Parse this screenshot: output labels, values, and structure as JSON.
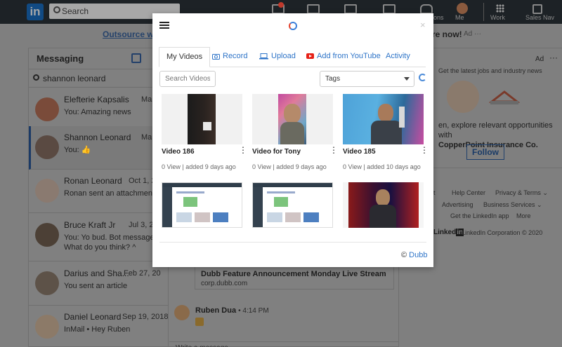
{
  "topbar": {
    "search_placeholder": "Search",
    "nav": [
      {
        "label": "",
        "icon": "home-icon"
      },
      {
        "label": "",
        "icon": "network-icon"
      },
      {
        "label": "",
        "icon": "jobs-icon"
      },
      {
        "label": "",
        "icon": "messaging-icon"
      },
      {
        "label": "ons",
        "icon": "notifications-icon"
      },
      {
        "label": "Me",
        "icon": "avatar"
      },
      {
        "label": "Work",
        "icon": "grid-icon"
      },
      {
        "label": "Sales Nav",
        "icon": "sales-nav-icon"
      }
    ]
  },
  "banner": {
    "left": "Outsource with",
    "right": "re now!",
    "ad_label": "Ad",
    "dots": "···"
  },
  "messaging": {
    "title": "Messaging",
    "search_value": "shannon leonard",
    "conversations": [
      {
        "name": "Elefterie Kapsalis",
        "date": "Mar",
        "preview": "You: Amazing news",
        "avatar_color": "#7a4b3a"
      },
      {
        "name": "Shannon Leonard",
        "date": "Mar",
        "preview": "You: 👍",
        "avatar_color": "#5a4a42"
      },
      {
        "name": "Ronan Leonard",
        "date": "Oct 1, 2",
        "preview": "Ronan sent an attachment",
        "avatar_color": "#8a7a70"
      },
      {
        "name": "Bruce Kraft Jr",
        "date": "Jul 3, 20",
        "preview": "You: Yo bud. Bot message. What do you think? ^",
        "avatar_color": "#4c4036"
      },
      {
        "name": "Darius and Sha...",
        "date": "Feb 27, 20",
        "preview": "You sent an article",
        "avatar_color": "#5d5248"
      },
      {
        "name": "Daniel Leonard",
        "date": "Sep 19, 2018",
        "preview": "InMail • Hey Ruben",
        "avatar_color": "#8c7a68"
      }
    ],
    "link_card": {
      "title": "Dubb Feature Announcement Monday Live Stream",
      "url": "corp.dubb.com"
    },
    "sender": {
      "name": "Ruben Dua",
      "time": "• 4:14 PM"
    },
    "write_placeholder": "Write a message..."
  },
  "ad": {
    "label": "Ad",
    "dots": "···",
    "top": "Get the latest jobs and industry news",
    "text_1": "en, explore relevant opportunities with",
    "company": "CopperPoint Insurance Co.",
    "follow": "Follow"
  },
  "footer_links": {
    "row1": [
      "ut",
      "Help Center",
      "Privacy & Terms ⌄"
    ],
    "row2": [
      "Advertising",
      "Business Services ⌄"
    ],
    "row3": [
      "Get the LinkedIn app",
      "More"
    ],
    "logo_text": "Linked",
    "logo_in": "in",
    "copyright": "LinkedIn Corporation © 2020"
  },
  "modal": {
    "close": "×",
    "tabs": [
      {
        "label": "My Videos",
        "icon": ""
      },
      {
        "label": "Record",
        "icon": "camera-icon"
      },
      {
        "label": "Upload",
        "icon": "laptop-icon"
      },
      {
        "label": "Add from YouTube",
        "icon": "youtube-icon"
      },
      {
        "label": "Activity",
        "icon": ""
      }
    ],
    "search_placeholder": "Search Videos",
    "tags_value": "Tags",
    "videos": [
      {
        "title": "Video 186",
        "meta": "0 View | added 9 days ago"
      },
      {
        "title": "Video for Tony",
        "meta": "0 View | added 9 days ago"
      },
      {
        "title": "Video 185",
        "meta": "0 View | added 10 days ago"
      },
      {
        "title": "",
        "meta": ""
      },
      {
        "title": "",
        "meta": ""
      },
      {
        "title": "",
        "meta": ""
      }
    ],
    "credit_symbol": "©",
    "credit": "Dubb",
    "colors": {
      "accent": "#2e74c8",
      "youtube": "#e62117",
      "logo_blue": "#3c7fd9",
      "logo_red": "#e4432f"
    }
  }
}
